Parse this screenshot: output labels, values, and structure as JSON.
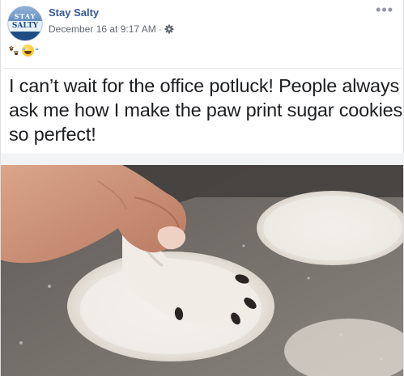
{
  "post": {
    "author": "Stay Salty",
    "avatar_text_top": "STAY",
    "avatar_text_bottom": "SALTY",
    "timestamp": "December 16 at 9:17 AM",
    "separator": "·",
    "privacy_icon": "gear-icon",
    "more_icon": "more-options-icon",
    "more_glyph": "•••",
    "emojis": [
      "paw-prints-icon",
      "laughing-emoji-icon"
    ],
    "caption": "I can’t wait for the office potluck! People always ask me how I make the paw print sugar cookies so perfect!",
    "photo_description_icon": "post-photo"
  },
  "colors": {
    "author_link": "#365899",
    "meta_text": "#616770",
    "caption_text": "#1c1e21",
    "divider": "#f2f3f5"
  }
}
